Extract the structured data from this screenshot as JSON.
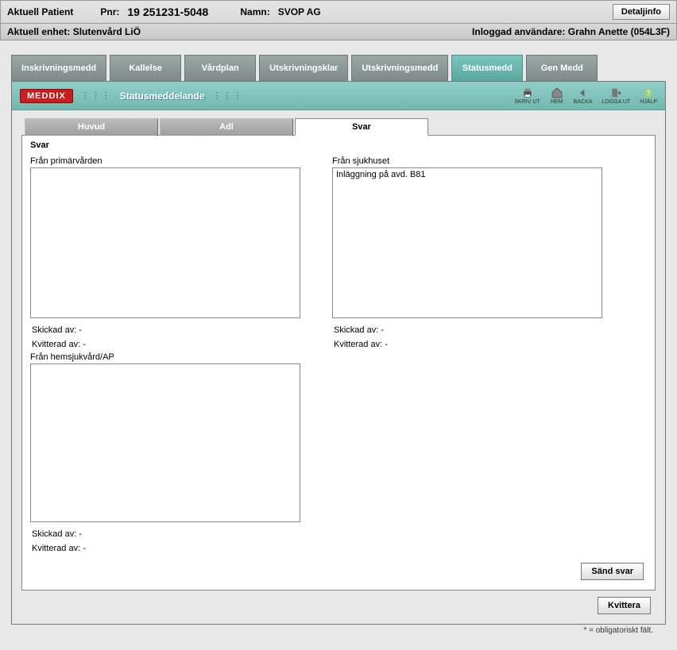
{
  "header": {
    "aktuell_patient_label": "Aktuell Patient",
    "pnr_label": "Pnr:",
    "pnr_value": "19 251231-5048",
    "namn_label": "Namn:",
    "namn_value": "SVOP AG",
    "detaljinfo_label": "Detaljinfo",
    "aktuell_enhet_label": "Aktuell enhet:",
    "aktuell_enhet_value": "Slutenvård LiÖ",
    "inloggad_label": "Inloggad användare:",
    "inloggad_value": "Grahn Anette (054L3F)"
  },
  "nav": {
    "tabs": [
      "Inskrivningsmedd",
      "Kallelse",
      "Vårdplan",
      "Utskrivningsklar",
      "Utskrivningsmedd",
      "Statusmedd",
      "Gen Medd"
    ],
    "active_index": 5
  },
  "toolbar": {
    "brand": "MEDDIX",
    "title": "Statusmeddelande",
    "icons": [
      {
        "name": "print-icon",
        "label": "SKRIV UT"
      },
      {
        "name": "home-icon",
        "label": "HEM"
      },
      {
        "name": "back-icon",
        "label": "BACKA"
      },
      {
        "name": "logout-icon",
        "label": "LOGGA UT"
      },
      {
        "name": "help-icon",
        "label": "HJÄLP"
      }
    ]
  },
  "subtabs": {
    "items": [
      "Huvud",
      "Adl",
      "Svar"
    ],
    "active_index": 2
  },
  "form": {
    "section_title": "Svar",
    "primarvarden": {
      "label": "Från primärvården",
      "value": "",
      "skickad": "Skickad av:   -",
      "kvitterad": "Kvitterad av: -"
    },
    "sjukhuset": {
      "label": "Från sjukhuset",
      "value": "Inläggning på avd. B81",
      "skickad": "Skickad av:   -",
      "kvitterad": "Kvitterad av: -"
    },
    "hemsjukvard": {
      "label": "Från hemsjukvård/AP",
      "value": "",
      "skickad": "Skickad av:   -",
      "kvitterad": "Kvitterad av: -"
    },
    "send_button": "Sänd svar"
  },
  "footer": {
    "kvittera": "Kvittera",
    "note": "* = obligatoriskt fält."
  }
}
